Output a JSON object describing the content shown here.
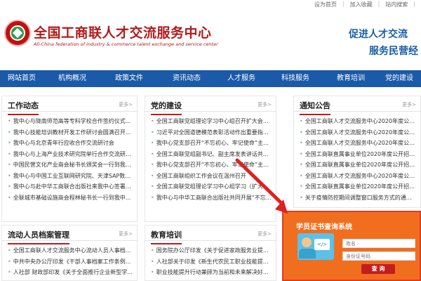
{
  "util": {
    "links": [
      "设为首页",
      "加入收藏",
      "站内搜索",
      "|"
    ]
  },
  "header": {
    "title_cn": "全国工商联人才交流服务中心",
    "title_en": "All-China federation of industry & commerce talent exchange and service center",
    "slogan1": "促进人才交流",
    "slogan2": "服务民营经"
  },
  "nav": [
    "网站首页",
    "机构概况",
    "政策文件",
    "资讯动态",
    "人才服务",
    "科技服务",
    "教育培训",
    "党的建设"
  ],
  "panels": {
    "work": {
      "title": "工作动态",
      "more": "更多>",
      "items": [
        "我中心与陇南师范高等专科学校合作签约仪式...",
        "我中心技能培训教材开发工作研讨会圆满召开...",
        "我中心与北京青年行应收合作交流研讨会",
        "我中心与上海产业技术研究院举行合作交流研讨...",
        "中国民营文化产业商会秘书长颁奖会一行到我中...",
        "我中心与中国工业互联网研究院、天津SAP数字...",
        "我中心与赴中华工商联合出版社来我中心签署教材...",
        "全联城市基础设施商会程林秘书长一行到我中..."
      ]
    },
    "party": {
      "title": "党的建设",
      "more": "更多>",
      "items": [
        "全国工商联党组理论学习中心组召开扩大会议...",
        "习近平对全国道德模范表彰活动作出重要指示...",
        "我中心党支部召开“不忘初心、牢记使命”主题...",
        "全国工商联党组副书记、副主席发表讲话共...",
        "我中心党支部召开“不忘初心、牢记使命”主题...",
        "全国工商联组织工作会议在温州召开",
        "全国工商联党组理论学习中心组学习（扩大）...",
        "我中心与中华工商联合出版社共同开展“不忘..."
      ]
    },
    "notice": {
      "title": "通知公告",
      "more": "更多>",
      "items": [
        "全国工商联人才交流服务中心2020年度公开...",
        "全国工商联人才交流服务中心2020年度公开...",
        "全国工商联人才交流服务中心2020年度公开...",
        "全国工商联直属事业单位2020年度公开招聘...",
        "全国工商联直属事业单位2020年度公开招聘...",
        "全国工商联人才交流服务中心2020年度公开...",
        "全国工商联直属事业单位2020年度公开招聘...",
        "关于疫情防控期间调整窗口服务方式的通知..."
      ]
    },
    "archive": {
      "title": "流动人员档案管理",
      "more": "更多>",
      "items": [
        "全国工商联人才交流服务中心流动人员人事档...",
        "中共中央办公厅印发《干部人事档案工作条例...",
        "人社部 财政部印发《关于全面推行企业新型学..."
      ]
    },
    "edu": {
      "title": "教育培训",
      "more": "更多>",
      "items": [
        "国务院办公厅印发《关于促进家政服务业提质...",
        "人社部关于印发《新生代农民工职业技能提升...",
        "职业技能提升行动兼顾为当前和未来解决好..."
      ]
    }
  },
  "service": {
    "title": "学员证书查询系统",
    "name_placeholder": "姓名",
    "id_placeholder": "身份证号码",
    "query_label": "查 询",
    "code_label": "</>"
  }
}
